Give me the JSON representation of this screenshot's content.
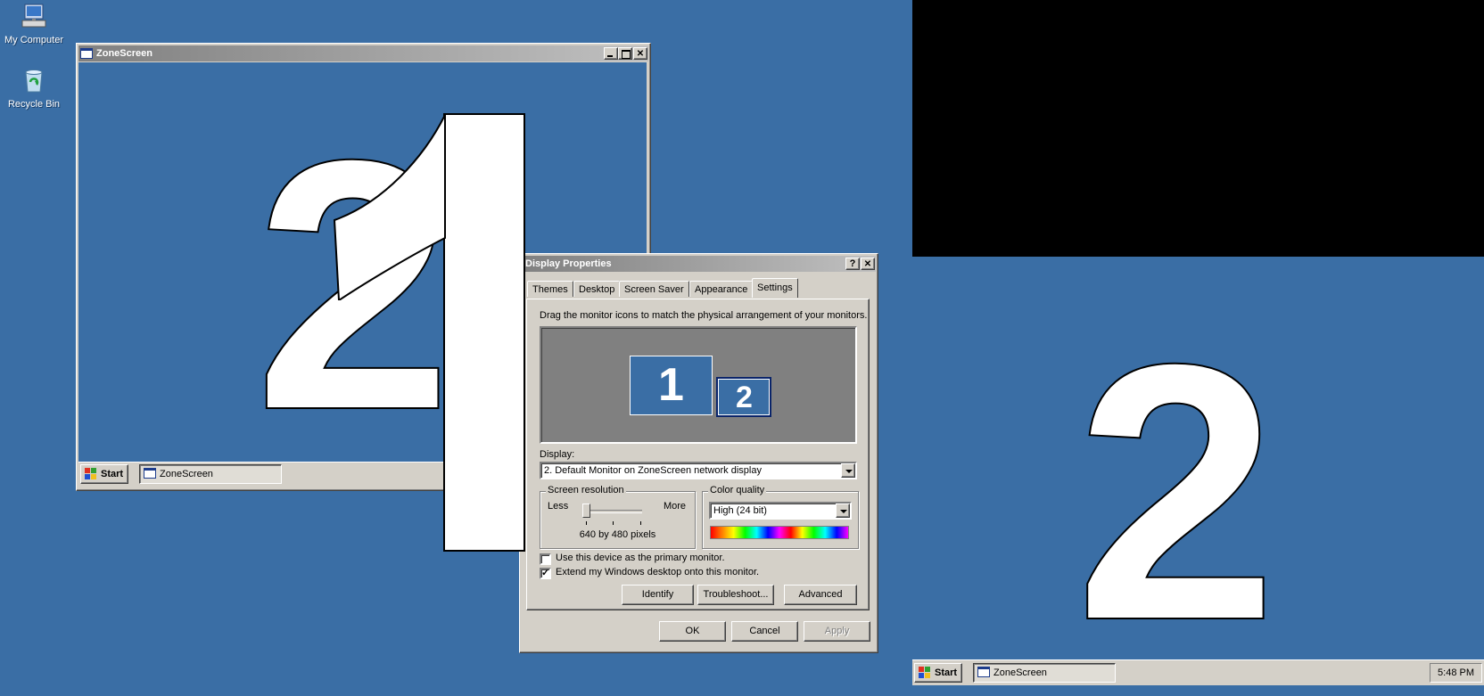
{
  "desktop": {
    "icons": [
      {
        "label": "My Computer"
      },
      {
        "label": "Recycle Bin"
      }
    ]
  },
  "zonescreen_window": {
    "title": "ZoneScreen",
    "taskbar": {
      "start_label": "Start",
      "task_label": "ZoneScreen"
    }
  },
  "overlays": {
    "identify_1": "1",
    "identify_2": "2"
  },
  "dialog": {
    "title": "Display Properties",
    "help_glyph": "?",
    "close_glyph": "✕",
    "tabs": [
      "Themes",
      "Desktop",
      "Screen Saver",
      "Appearance",
      "Settings"
    ],
    "active_tab": "Settings",
    "instructions": "Drag the monitor icons to match the physical arrangement of your monitors.",
    "monitors": [
      {
        "label": "1"
      },
      {
        "label": "2"
      }
    ],
    "display_label": "Display:",
    "display_value": "2. Default Monitor on ZoneScreen network display",
    "resolution": {
      "title": "Screen resolution",
      "less": "Less",
      "more": "More",
      "value": "640 by 480 pixels"
    },
    "color_quality": {
      "title": "Color quality",
      "value": "High (24 bit)"
    },
    "checkboxes": [
      {
        "label": "Use this device as the primary monitor.",
        "checked": false
      },
      {
        "label": "Extend my Windows desktop onto this monitor.",
        "checked": true
      }
    ],
    "check_mark": "✓",
    "buttons": {
      "identify": "Identify",
      "troubleshoot": "Troubleshoot...",
      "advanced": "Advanced",
      "ok": "OK",
      "cancel": "Cancel",
      "apply": "Apply"
    }
  },
  "second_screen": {
    "taskbar": {
      "start_label": "Start",
      "task_label": "ZoneScreen",
      "clock": "5:48 PM"
    }
  },
  "colors": {
    "desktop": "#3a6ea5",
    "title_active": "#0a246a",
    "dialog_face": "#d4d0c8",
    "preview_bg": "#808080"
  }
}
